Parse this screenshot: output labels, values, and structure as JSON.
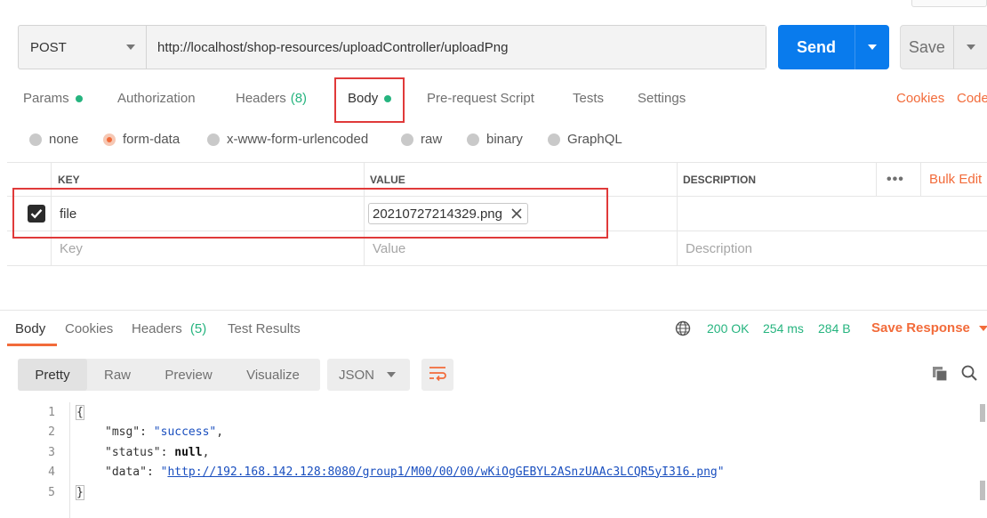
{
  "request": {
    "method": "POST",
    "url": "http://localhost/shop-resources/uploadController/uploadPng",
    "send_label": "Send",
    "save_label": "Save"
  },
  "request_tabs": [
    {
      "label": "Params",
      "dot": true
    },
    {
      "label": "Authorization"
    },
    {
      "label": "Headers",
      "count": "(8)"
    },
    {
      "label": "Body",
      "dot": true,
      "active": true
    },
    {
      "label": "Pre-request Script"
    },
    {
      "label": "Tests"
    },
    {
      "label": "Settings"
    }
  ],
  "links": {
    "cookies": "Cookies",
    "code": "Code"
  },
  "body_types": [
    {
      "label": "none"
    },
    {
      "label": "form-data",
      "selected": true
    },
    {
      "label": "x-www-form-urlencoded"
    },
    {
      "label": "raw"
    },
    {
      "label": "binary"
    },
    {
      "label": "GraphQL"
    }
  ],
  "params_table": {
    "headers": {
      "key": "KEY",
      "value": "VALUE",
      "description": "DESCRIPTION",
      "more": "•••",
      "bulk_edit": "Bulk Edit"
    },
    "rows": [
      {
        "checked": true,
        "key": "file",
        "value_file": "20210727214329.png"
      }
    ],
    "placeholders": {
      "key": "Key",
      "value": "Value",
      "description": "Description"
    }
  },
  "response_tabs": [
    {
      "label": "Body",
      "active": true
    },
    {
      "label": "Cookies"
    },
    {
      "label": "Headers",
      "count": "(5)"
    },
    {
      "label": "Test Results"
    }
  ],
  "response_status": {
    "status": "200 OK",
    "time": "254 ms",
    "size": "284 B",
    "save_response": "Save Response"
  },
  "view_modes": [
    {
      "label": "Pretty",
      "active": true
    },
    {
      "label": "Raw"
    },
    {
      "label": "Preview"
    },
    {
      "label": "Visualize"
    }
  ],
  "format_select": "JSON",
  "response_body": {
    "line_numbers": [
      "1",
      "2",
      "3",
      "4",
      "5"
    ],
    "open_brace": "{",
    "close_brace": "}",
    "lines": [
      {
        "key": "\"msg\"",
        "sep": ": ",
        "value": "\"success\"",
        "tail": ","
      },
      {
        "key": "\"status\"",
        "sep": ": ",
        "value": "null",
        "tail": ","
      },
      {
        "key": "\"data\"",
        "sep": ": ",
        "value_quote_open": "\"",
        "value": "http://192.168.142.128:8080/group1/M00/00/00/wKiOgGEBYL2ASnzUAAc3LCQR5yI316.png",
        "value_quote_close": "\""
      }
    ]
  },
  "colors": {
    "accent": "#f26b3a",
    "primary_button": "#097bed",
    "success": "#26b47f",
    "highlight_box": "#e03a3a"
  }
}
